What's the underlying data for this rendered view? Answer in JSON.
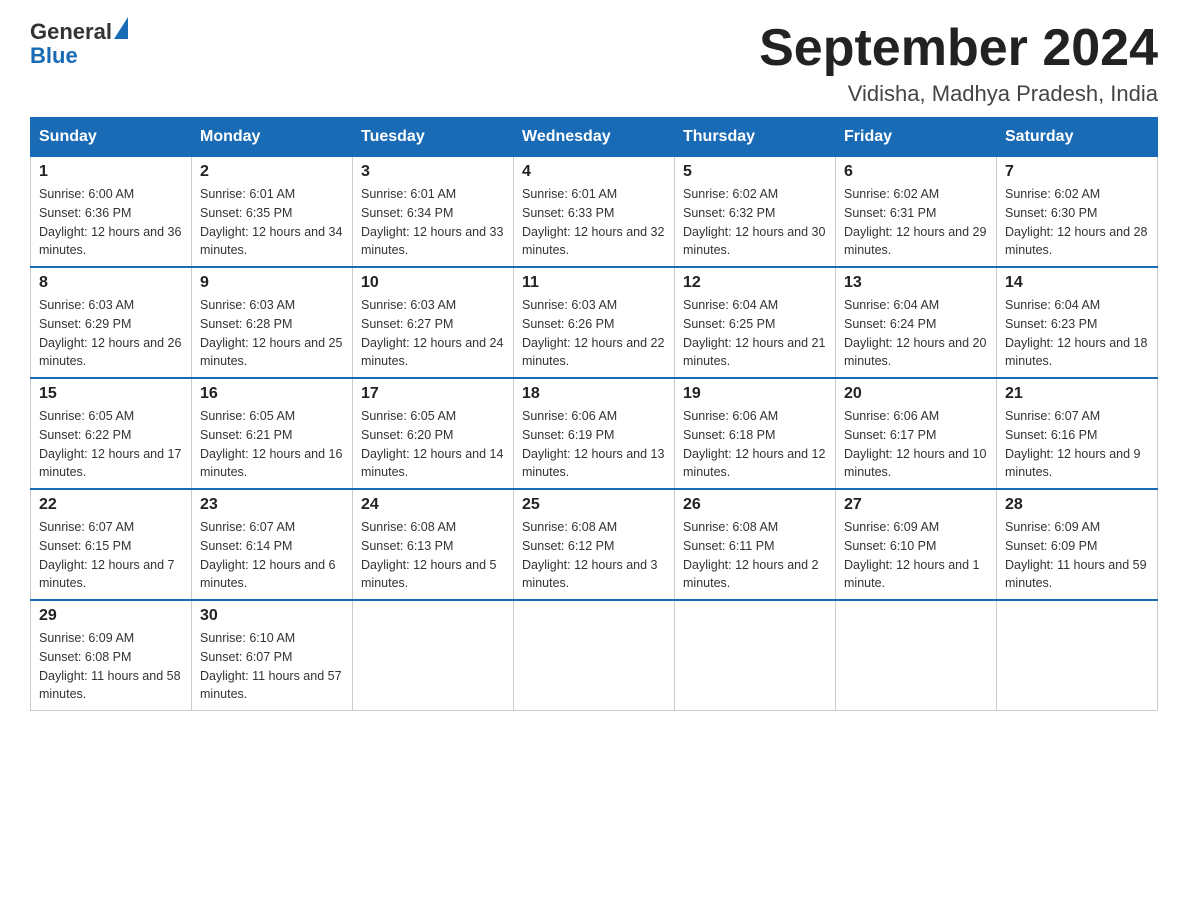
{
  "header": {
    "logo_general": "General",
    "logo_blue": "Blue",
    "title": "September 2024",
    "subtitle": "Vidisha, Madhya Pradesh, India"
  },
  "days_of_week": [
    "Sunday",
    "Monday",
    "Tuesday",
    "Wednesday",
    "Thursday",
    "Friday",
    "Saturday"
  ],
  "weeks": [
    [
      {
        "day": "1",
        "sunrise": "6:00 AM",
        "sunset": "6:36 PM",
        "daylight": "12 hours and 36 minutes."
      },
      {
        "day": "2",
        "sunrise": "6:01 AM",
        "sunset": "6:35 PM",
        "daylight": "12 hours and 34 minutes."
      },
      {
        "day": "3",
        "sunrise": "6:01 AM",
        "sunset": "6:34 PM",
        "daylight": "12 hours and 33 minutes."
      },
      {
        "day": "4",
        "sunrise": "6:01 AM",
        "sunset": "6:33 PM",
        "daylight": "12 hours and 32 minutes."
      },
      {
        "day": "5",
        "sunrise": "6:02 AM",
        "sunset": "6:32 PM",
        "daylight": "12 hours and 30 minutes."
      },
      {
        "day": "6",
        "sunrise": "6:02 AM",
        "sunset": "6:31 PM",
        "daylight": "12 hours and 29 minutes."
      },
      {
        "day": "7",
        "sunrise": "6:02 AM",
        "sunset": "6:30 PM",
        "daylight": "12 hours and 28 minutes."
      }
    ],
    [
      {
        "day": "8",
        "sunrise": "6:03 AM",
        "sunset": "6:29 PM",
        "daylight": "12 hours and 26 minutes."
      },
      {
        "day": "9",
        "sunrise": "6:03 AM",
        "sunset": "6:28 PM",
        "daylight": "12 hours and 25 minutes."
      },
      {
        "day": "10",
        "sunrise": "6:03 AM",
        "sunset": "6:27 PM",
        "daylight": "12 hours and 24 minutes."
      },
      {
        "day": "11",
        "sunrise": "6:03 AM",
        "sunset": "6:26 PM",
        "daylight": "12 hours and 22 minutes."
      },
      {
        "day": "12",
        "sunrise": "6:04 AM",
        "sunset": "6:25 PM",
        "daylight": "12 hours and 21 minutes."
      },
      {
        "day": "13",
        "sunrise": "6:04 AM",
        "sunset": "6:24 PM",
        "daylight": "12 hours and 20 minutes."
      },
      {
        "day": "14",
        "sunrise": "6:04 AM",
        "sunset": "6:23 PM",
        "daylight": "12 hours and 18 minutes."
      }
    ],
    [
      {
        "day": "15",
        "sunrise": "6:05 AM",
        "sunset": "6:22 PM",
        "daylight": "12 hours and 17 minutes."
      },
      {
        "day": "16",
        "sunrise": "6:05 AM",
        "sunset": "6:21 PM",
        "daylight": "12 hours and 16 minutes."
      },
      {
        "day": "17",
        "sunrise": "6:05 AM",
        "sunset": "6:20 PM",
        "daylight": "12 hours and 14 minutes."
      },
      {
        "day": "18",
        "sunrise": "6:06 AM",
        "sunset": "6:19 PM",
        "daylight": "12 hours and 13 minutes."
      },
      {
        "day": "19",
        "sunrise": "6:06 AM",
        "sunset": "6:18 PM",
        "daylight": "12 hours and 12 minutes."
      },
      {
        "day": "20",
        "sunrise": "6:06 AM",
        "sunset": "6:17 PM",
        "daylight": "12 hours and 10 minutes."
      },
      {
        "day": "21",
        "sunrise": "6:07 AM",
        "sunset": "6:16 PM",
        "daylight": "12 hours and 9 minutes."
      }
    ],
    [
      {
        "day": "22",
        "sunrise": "6:07 AM",
        "sunset": "6:15 PM",
        "daylight": "12 hours and 7 minutes."
      },
      {
        "day": "23",
        "sunrise": "6:07 AM",
        "sunset": "6:14 PM",
        "daylight": "12 hours and 6 minutes."
      },
      {
        "day": "24",
        "sunrise": "6:08 AM",
        "sunset": "6:13 PM",
        "daylight": "12 hours and 5 minutes."
      },
      {
        "day": "25",
        "sunrise": "6:08 AM",
        "sunset": "6:12 PM",
        "daylight": "12 hours and 3 minutes."
      },
      {
        "day": "26",
        "sunrise": "6:08 AM",
        "sunset": "6:11 PM",
        "daylight": "12 hours and 2 minutes."
      },
      {
        "day": "27",
        "sunrise": "6:09 AM",
        "sunset": "6:10 PM",
        "daylight": "12 hours and 1 minute."
      },
      {
        "day": "28",
        "sunrise": "6:09 AM",
        "sunset": "6:09 PM",
        "daylight": "11 hours and 59 minutes."
      }
    ],
    [
      {
        "day": "29",
        "sunrise": "6:09 AM",
        "sunset": "6:08 PM",
        "daylight": "11 hours and 58 minutes."
      },
      {
        "day": "30",
        "sunrise": "6:10 AM",
        "sunset": "6:07 PM",
        "daylight": "11 hours and 57 minutes."
      },
      null,
      null,
      null,
      null,
      null
    ]
  ],
  "labels": {
    "sunrise": "Sunrise: ",
    "sunset": "Sunset: ",
    "daylight": "Daylight: "
  }
}
